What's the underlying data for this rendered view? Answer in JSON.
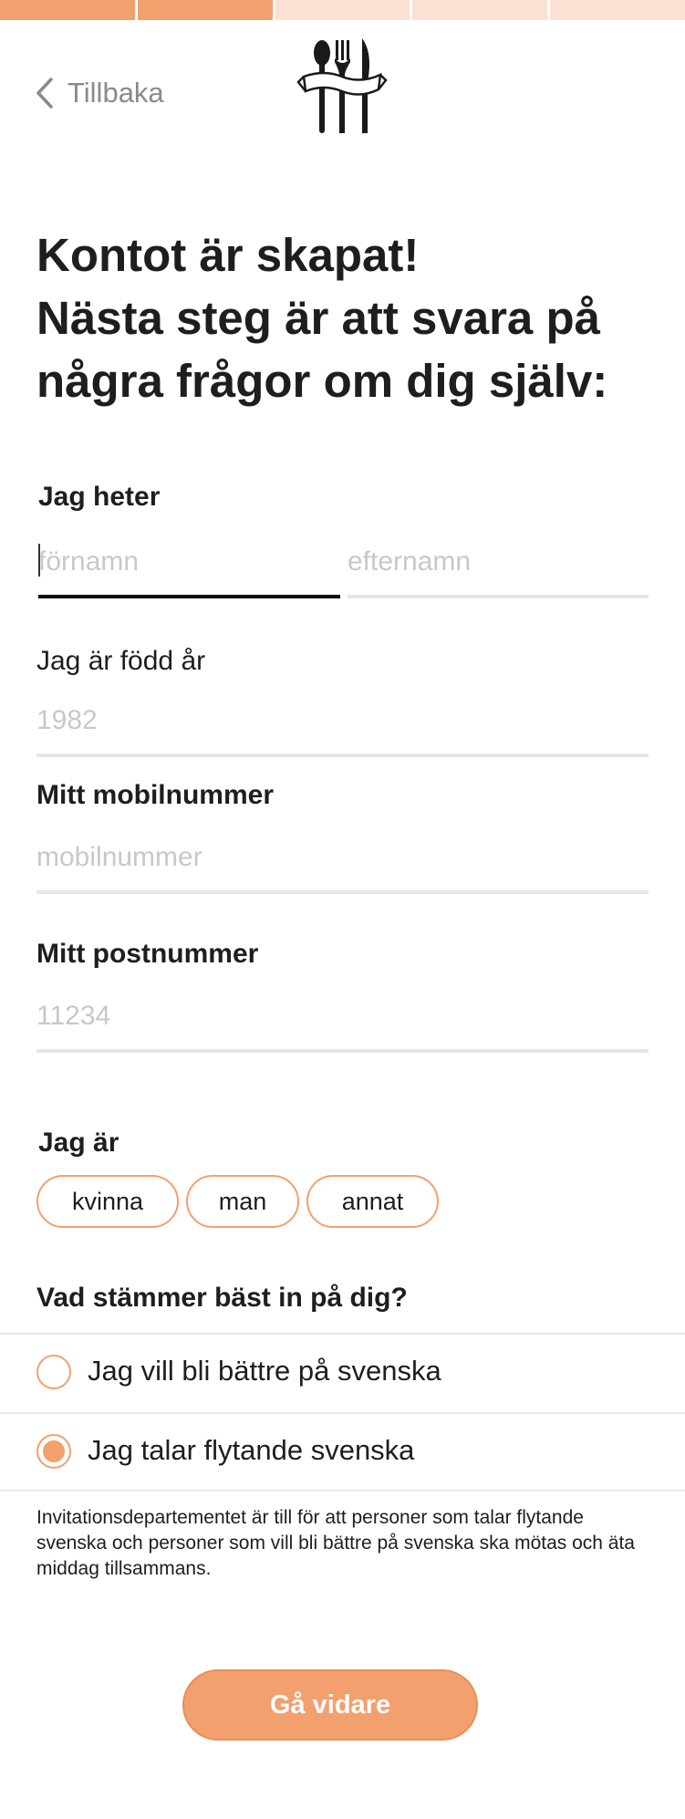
{
  "progress": {
    "total_steps": 5,
    "completed_steps": 2,
    "done_color": "#f2a06e",
    "todo_color": "#fbe1d1"
  },
  "header": {
    "back_label": "Tillbaka",
    "logo_icon": "cutlery-ribbon-logo"
  },
  "headline": {
    "line1": "Kontot är skapat!",
    "line2": "Nästa steg är att svara på",
    "line3": "några frågor om dig själv:"
  },
  "form": {
    "name_label": "Jag heter",
    "first_name_placeholder": "förnamn",
    "last_name_placeholder": "efternamn",
    "birth_year_label": "Jag är född år",
    "birth_year_placeholder": "1982",
    "mobile_label": "Mitt mobilnummer",
    "mobile_placeholder": "mobilnummer",
    "postcode_label": "Mitt postnummer",
    "postcode_placeholder": "11234",
    "gender_label": "Jag är",
    "gender_options": [
      "kvinna",
      "man",
      "annat"
    ],
    "language_question": "Vad stämmer bäst in på dig?",
    "language_options": [
      {
        "label": "Jag vill bli bättre på svenska",
        "selected": false
      },
      {
        "label": "Jag talar flytande svenska",
        "selected": true
      }
    ]
  },
  "info_text": "Invitationsdepartementet är till för att personer som talar flytande svenska och personer som vill bli bättre på svenska ska mötas och äta middag tillsammans.",
  "submit_label": "Gå vidare",
  "accent_color": "#f2a06e"
}
